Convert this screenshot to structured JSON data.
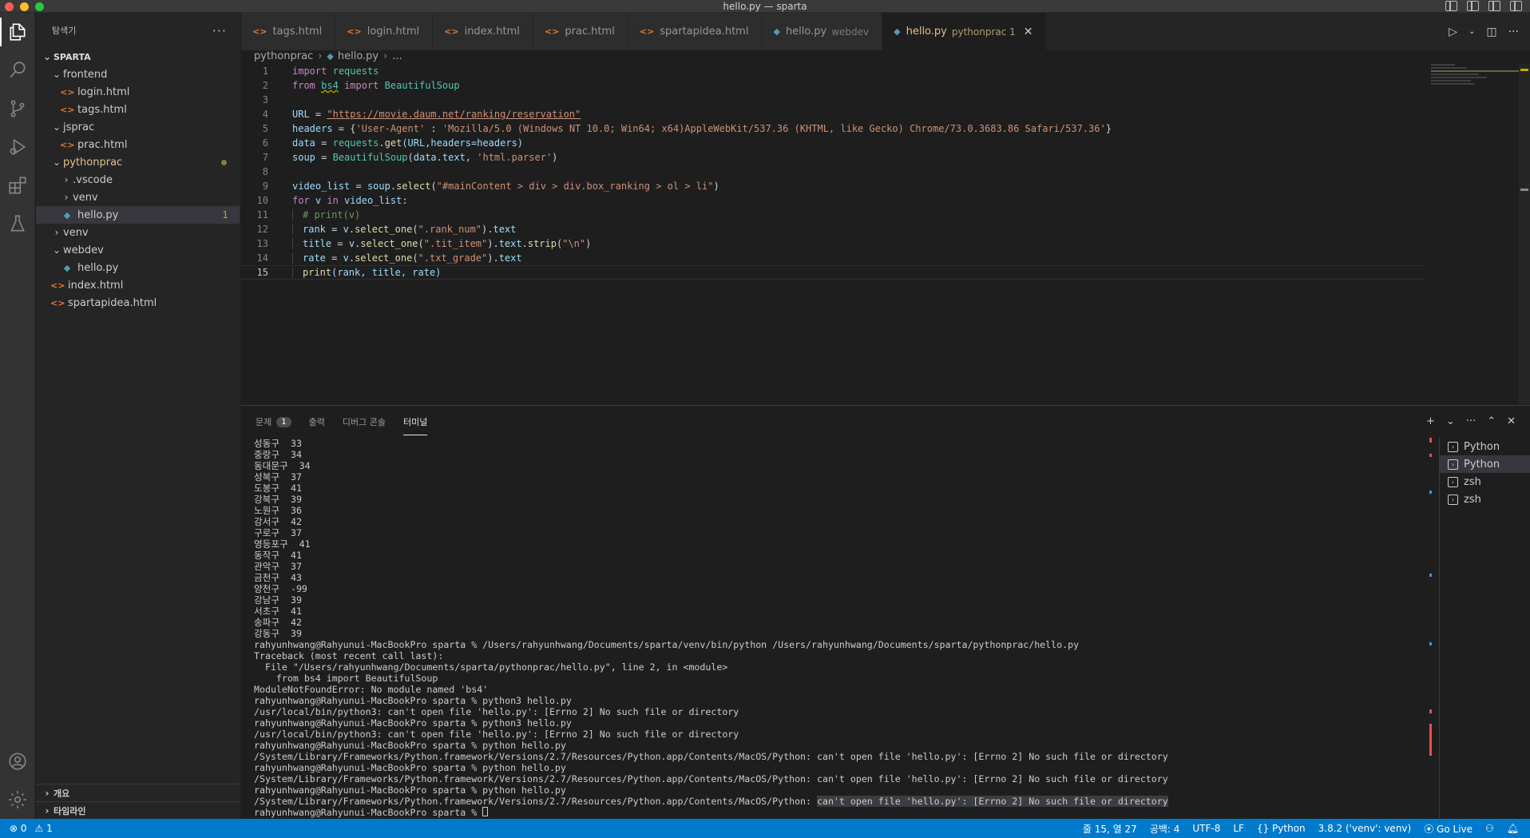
{
  "window_title": "hello.py — sparta",
  "sidebar": {
    "title": "탐색기",
    "more": "···",
    "root": "SPARTA",
    "tree": [
      {
        "label": "frontend",
        "type": "folder",
        "open": true,
        "depth": 1
      },
      {
        "label": "login.html",
        "type": "html",
        "depth": 2
      },
      {
        "label": "tags.html",
        "type": "html",
        "depth": 2
      },
      {
        "label": "jsprac",
        "type": "folder",
        "open": true,
        "depth": 1
      },
      {
        "label": "prac.html",
        "type": "html",
        "depth": 2
      },
      {
        "label": "pythonprac",
        "type": "folder",
        "open": true,
        "depth": 1,
        "modified": true
      },
      {
        "label": ".vscode",
        "type": "folder",
        "open": false,
        "depth": 2
      },
      {
        "label": "venv",
        "type": "folder",
        "open": false,
        "depth": 2
      },
      {
        "label": "hello.py",
        "type": "py",
        "depth": 2,
        "selected": true,
        "badge": "1"
      },
      {
        "label": "venv",
        "type": "folder",
        "open": false,
        "depth": 1
      },
      {
        "label": "webdev",
        "type": "folder",
        "open": true,
        "depth": 1
      },
      {
        "label": "hello.py",
        "type": "py",
        "depth": 2
      },
      {
        "label": "index.html",
        "type": "html",
        "depth": 1
      },
      {
        "label": "spartapidea.html",
        "type": "html",
        "depth": 1
      }
    ],
    "outline": "개요",
    "timeline": "타임라인"
  },
  "tabs": [
    {
      "label": "tags.html",
      "type": "html"
    },
    {
      "label": "login.html",
      "type": "html"
    },
    {
      "label": "index.html",
      "type": "html"
    },
    {
      "label": "prac.html",
      "type": "html"
    },
    {
      "label": "spartapidea.html",
      "type": "html"
    },
    {
      "label": "hello.py",
      "type": "py",
      "desc": "webdev"
    },
    {
      "label": "hello.py",
      "type": "py",
      "desc": "pythonprac 1",
      "active": true
    }
  ],
  "breadcrumb": [
    "pythonprac",
    "hello.py",
    "..."
  ],
  "editor": {
    "line_numbers": [
      "1",
      "2",
      "3",
      "4",
      "5",
      "6",
      "7",
      "8",
      "9",
      "10",
      "11",
      "12",
      "13",
      "14",
      "15"
    ],
    "line1": {
      "kw": "import",
      "mod": "requests"
    },
    "line2": {
      "kw1": "from",
      "mod": "bs4",
      "kw2": "import",
      "cls": "BeautifulSoup"
    },
    "line4": {
      "var": "URL",
      "eq": " = ",
      "url": "\"https://movie.daum.net/ranking/reservation\""
    },
    "line5": {
      "var": "headers",
      "eq": " = {",
      "key": "'User-Agent'",
      "colon": " : ",
      "val": "'Mozilla/5.0 (Windows NT 10.0; Win64; x64)AppleWebKit/537.36 (KHTML, like Gecko) Chrome/73.0.3683.86 Safari/537.36'",
      "end": "}"
    },
    "line6": {
      "var": "data",
      "eq": " = ",
      "obj": "requests",
      "dot": ".",
      "fn": "get",
      "args": "(URL,headers=headers)"
    },
    "line7": {
      "var": "soup",
      "eq": " = ",
      "cls": "BeautifulSoup",
      "open": "(",
      "arg1": "data",
      "dot": ".",
      "attr": "text",
      "comma": ", ",
      "str": "'html.parser'",
      "close": ")"
    },
    "line9": {
      "var": "video_list",
      "eq": " = ",
      "obj": "soup",
      "dot": ".",
      "fn": "select",
      "open": "(",
      "str": "\"#mainContent > div > div.box_ranking > ol > li\"",
      "close": ")"
    },
    "line10": {
      "kw1": "for",
      "v": " v ",
      "kw2": "in",
      "list": " video_list",
      "colon": ":"
    },
    "line11": {
      "comment": "# print(v)"
    },
    "line12": {
      "var": "rank",
      "eq": " = ",
      "obj": "v",
      "fn": "select_one",
      "str": "\".rank_num\"",
      "attr": "text"
    },
    "line13": {
      "var": "title",
      "eq": " = ",
      "obj": "v",
      "fn": "select_one",
      "str": "\".tit_item\"",
      "attr": "text",
      "fn2": "strip",
      "str2": "\"\\n\""
    },
    "line14": {
      "var": "rate",
      "eq": " = ",
      "obj": "v",
      "fn": "select_one",
      "str": "\".txt_grade\"",
      "attr": "text"
    },
    "line15": {
      "fn": "print",
      "args": "(rank, title, rate)"
    }
  },
  "panel": {
    "tabs": [
      {
        "label": "문제",
        "count": "1"
      },
      {
        "label": "출력"
      },
      {
        "label": "디버그 콘솔"
      },
      {
        "label": "터미널",
        "active": true
      }
    ],
    "actions": [
      "+",
      "⌄",
      "···",
      "⌃",
      "✕"
    ],
    "terminal_lines": [
      {
        "text": "성동구  33"
      },
      {
        "text": "중랑구  34"
      },
      {
        "text": "동대문구  34"
      },
      {
        "text": "성북구  37"
      },
      {
        "text": "도봉구  41"
      },
      {
        "text": "강북구  39"
      },
      {
        "text": "노원구  36"
      },
      {
        "text": "강서구  42"
      },
      {
        "text": "구로구  37"
      },
      {
        "text": "영등포구  41"
      },
      {
        "text": "동작구  41"
      },
      {
        "text": "관악구  37"
      },
      {
        "text": "금천구  43"
      },
      {
        "text": "양천구  -99"
      },
      {
        "text": "강남구  39"
      },
      {
        "text": "서초구  41"
      },
      {
        "text": "송파구  42"
      },
      {
        "text": "강동구  39"
      },
      {
        "text": "rahyunhwang@Rahyunui-MacBookPro sparta % /Users/rahyunhwang/Documents/sparta/venv/bin/python /Users/rahyunhwang/Documents/sparta/pythonprac/hello.py",
        "mark": "err"
      },
      {
        "text": "Traceback (most recent call last):"
      },
      {
        "text": "  File \"/Users/rahyunhwang/Documents/sparta/pythonprac/hello.py\", line 2, in <module>"
      },
      {
        "text": "    from bs4 import BeautifulSoup"
      },
      {
        "text": "ModuleNotFoundError: No module named 'bs4'"
      },
      {
        "text": "rahyunhwang@Rahyunui-MacBookPro sparta % python3 hello.py",
        "mark": "err"
      },
      {
        "text": "/usr/local/bin/python3: can't open file 'hello.py': [Errno 2] No such file or directory"
      },
      {
        "text": "rahyunhwang@Rahyunui-MacBookPro sparta % python3 hello.py",
        "mark": "err"
      },
      {
        "text": "/usr/local/bin/python3: can't open file 'hello.py': [Errno 2] No such file or directory"
      },
      {
        "text": "rahyunhwang@Rahyunui-MacBookPro sparta % python hello.py",
        "mark": "err"
      },
      {
        "text": "/System/Library/Frameworks/Python.framework/Versions/2.7/Resources/Python.app/Contents/MacOS/Python: can't open file 'hello.py': [Errno 2] No such file or directory"
      },
      {
        "text": "rahyunhwang@Rahyunui-MacBookPro sparta % python hello.py",
        "mark": "err"
      },
      {
        "text": "/System/Library/Frameworks/Python.framework/Versions/2.7/Resources/Python.app/Contents/MacOS/Python: can't open file 'hello.py': [Errno 2] No such file or directory"
      },
      {
        "text": "rahyunhwang@Rahyunui-MacBookPro sparta % python hello.py",
        "mark": "err"
      },
      {
        "text": "/System/Library/Frameworks/Python.framework/Versions/2.7/Resources/Python.app/Contents/MacOS/Python: ",
        "hl": "can't open file 'hello.py': [Errno 2] No such file or directory"
      },
      {
        "text": "rahyunhwang@Rahyunui-MacBookPro sparta % ",
        "mark": "idle",
        "cursor": true
      }
    ],
    "terminals": [
      {
        "label": "Python"
      },
      {
        "label": "Python",
        "active": true
      },
      {
        "label": "zsh"
      },
      {
        "label": "zsh"
      }
    ]
  },
  "statusbar": {
    "errors": "⊗ 0",
    "warnings": "⚠ 1",
    "position": "줄 15, 열 27",
    "spaces": "공백: 4",
    "encoding": "UTF-8",
    "eol": "LF",
    "language": "{} Python",
    "interpreter": "3.8.2 ('venv': venv)",
    "golive": "⦿ Go Live"
  },
  "colors": {
    "accent": "#007acc",
    "error": "#f14c4c",
    "warning": "#cca700",
    "modified": "#e2c08d"
  }
}
